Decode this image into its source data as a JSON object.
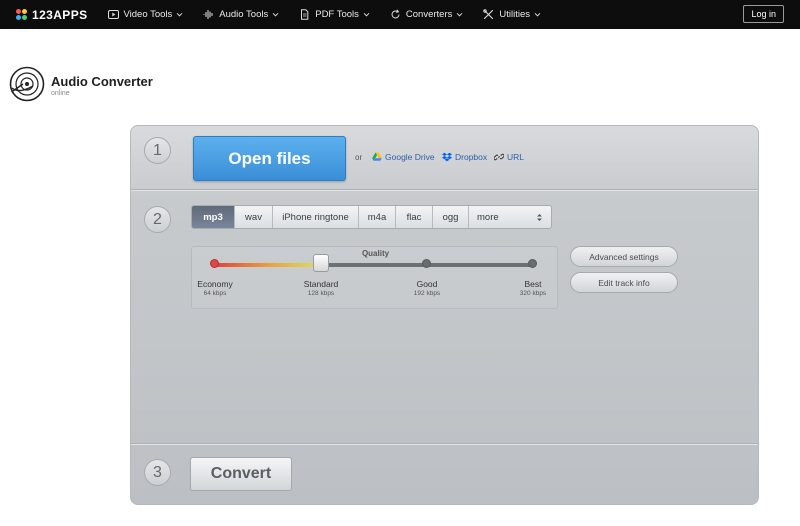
{
  "nav": {
    "logo": "123APPS",
    "items": [
      {
        "label": "Video Tools",
        "icon": "play-icon"
      },
      {
        "label": "Audio Tools",
        "icon": "waveform-icon"
      },
      {
        "label": "PDF Tools",
        "icon": "document-icon"
      },
      {
        "label": "Converters",
        "icon": "refresh-icon"
      },
      {
        "label": "Utilities",
        "icon": "tools-icon"
      }
    ],
    "login": "Log in"
  },
  "app": {
    "title": "Audio Converter",
    "subtitle": "online"
  },
  "step1": {
    "number": "1",
    "open_files": "Open files",
    "or": "or",
    "google_drive": "Google Drive",
    "dropbox": "Dropbox",
    "url": "URL"
  },
  "step2": {
    "number": "2",
    "formats": [
      "mp3",
      "wav",
      "iPhone ringtone",
      "m4a",
      "flac",
      "ogg"
    ],
    "more": "more",
    "selected_format": "mp3",
    "quality": {
      "title": "Quality",
      "levels": [
        {
          "label": "Economy",
          "kbps": "64 kbps"
        },
        {
          "label": "Standard",
          "kbps": "128 kbps"
        },
        {
          "label": "Good",
          "kbps": "192 kbps"
        },
        {
          "label": "Best",
          "kbps": "320 kbps"
        }
      ],
      "selected_index": 1
    },
    "advanced_settings": "Advanced settings",
    "edit_track_info": "Edit track info"
  },
  "step3": {
    "number": "3",
    "convert": "Convert"
  },
  "colors": {
    "nav_bg": "#0d0d0d",
    "accent_blue": "#3a8ed6",
    "link": "#2d5fa8",
    "active_format": "#667386"
  }
}
